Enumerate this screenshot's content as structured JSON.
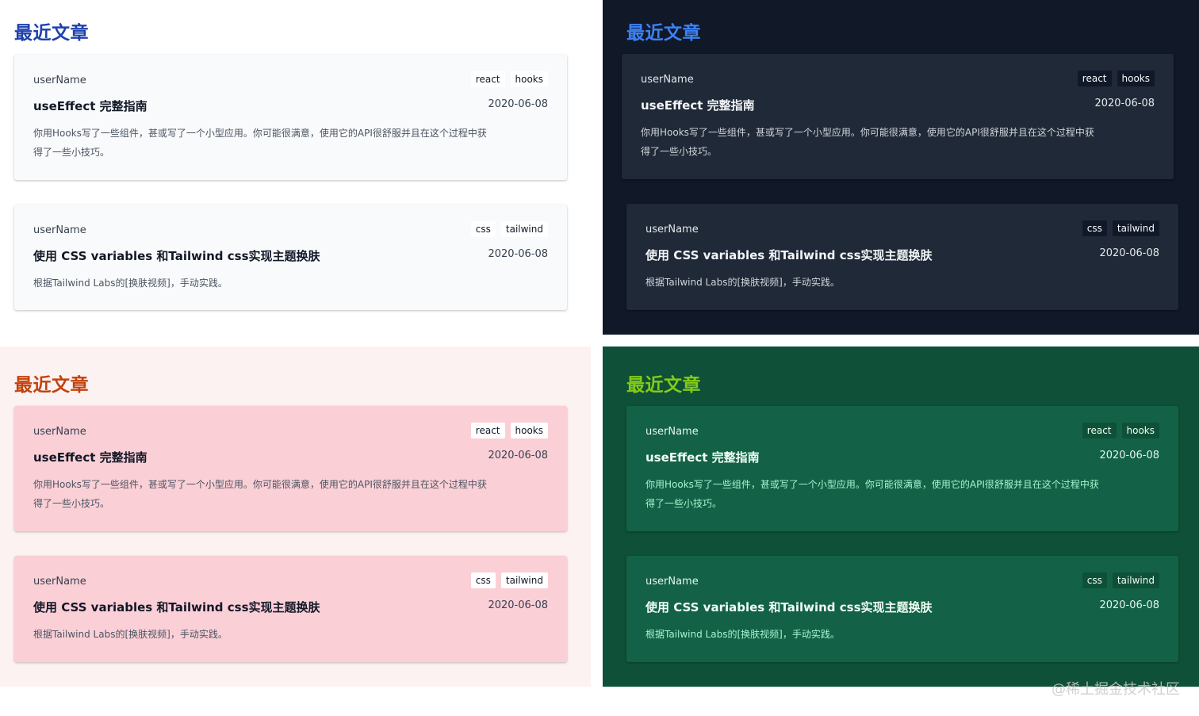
{
  "section_title": "最近文章",
  "themes": [
    {
      "name": "light"
    },
    {
      "name": "dark"
    },
    {
      "name": "pink"
    },
    {
      "name": "green"
    }
  ],
  "articles": [
    {
      "author": "userName",
      "title": "useEffect 完整指南",
      "date": "2020-06-08",
      "excerpt": "你用Hooks写了一些组件，甚或写了一个小型应用。你可能很满意，使用它的API很舒服并且在这个过程中获得了一些小技巧。",
      "tags": [
        "react",
        "hooks"
      ]
    },
    {
      "author": "userName",
      "title": "使用 CSS variables 和Tailwind css实现主题换肤",
      "date": "2020-06-08",
      "excerpt": "根据Tailwind Labs的[换肤视频]，手动实践。",
      "tags": [
        "css",
        "tailwind"
      ]
    }
  ],
  "colors": {
    "light_title": "#1e40af",
    "dark_title": "#3b82f6",
    "pink_title": "#c2410c",
    "green_title": "#84cc16"
  },
  "watermark": "@稀土掘金技术社区"
}
